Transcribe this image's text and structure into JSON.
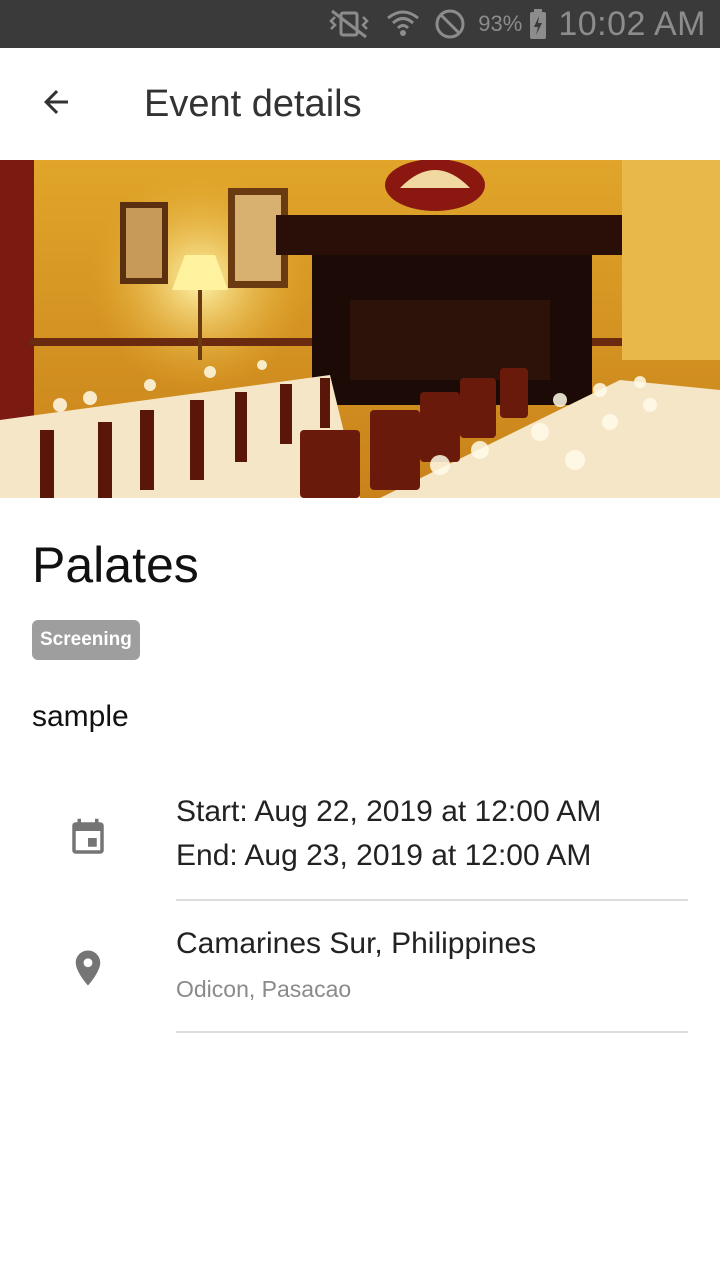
{
  "status_bar": {
    "battery_percent": "93%",
    "time": "10:02 AM",
    "icons": [
      "vibrate-icon",
      "wifi-icon",
      "do-not-disturb-icon",
      "battery-charging-icon"
    ]
  },
  "app_bar": {
    "title": "Event details",
    "back_icon": "arrow-back-icon"
  },
  "hero": {
    "image_subject": "restaurant dining room with set tables"
  },
  "event": {
    "title": "Palates",
    "tag": "Screening",
    "description": "sample",
    "schedule": {
      "icon": "calendar-icon",
      "start": "Start: Aug 22, 2019 at 12:00 AM",
      "end": "End: Aug 23, 2019 at 12:00 AM"
    },
    "location": {
      "icon": "location-pin-icon",
      "primary": "Camarines Sur, Philippines",
      "secondary": "Odicon, Pasacao"
    }
  },
  "colors": {
    "status_bar": "#3a3a3a",
    "tag_background": "#9e9e9e",
    "icon": "#757575"
  }
}
